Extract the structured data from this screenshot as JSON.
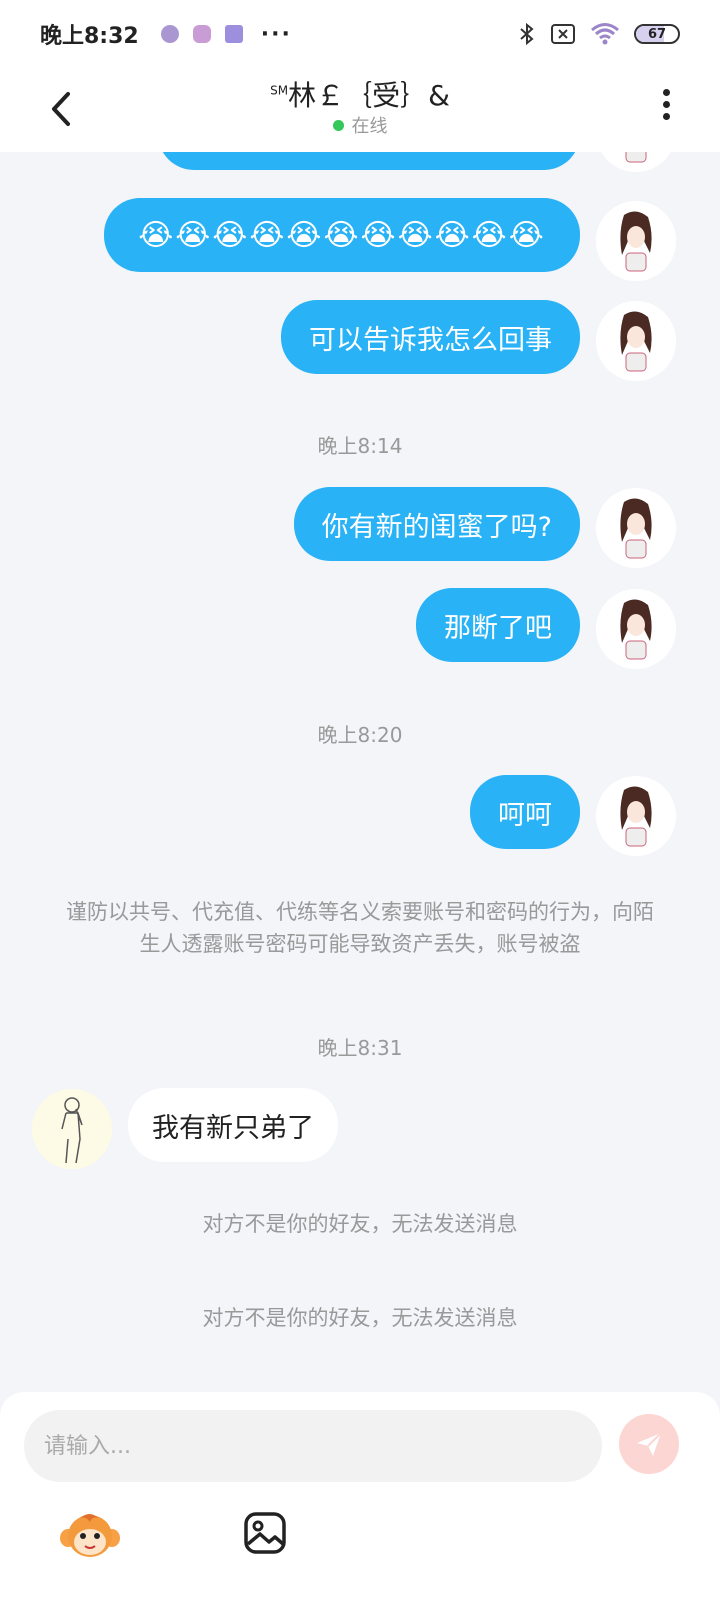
{
  "status_bar": {
    "time": "晚上8:32",
    "dots": "···",
    "battery": "67",
    "battery_level": 0.67
  },
  "header": {
    "title": "林￡｛受｝&",
    "title_superscript": "SM",
    "status": "在线"
  },
  "messages": [
    {
      "type": "out",
      "emoji": "😭😭😭😭😭😭😭😭😭😭😭"
    },
    {
      "type": "out",
      "text": "可以告诉我怎么回事"
    },
    {
      "type": "time",
      "text": "晚上8:14"
    },
    {
      "type": "out",
      "text": "你有新的闺蜜了吗?"
    },
    {
      "type": "out",
      "text": "那断了吧"
    },
    {
      "type": "time",
      "text": "晚上8:20"
    },
    {
      "type": "out",
      "text": "呵呵"
    },
    {
      "type": "notice",
      "text": "谨防以共号、代充值、代练等名义索要账号和密码的行为，向陌生人透露账号密码可能导致资产丢失，账号被盗"
    },
    {
      "type": "time",
      "text": "晚上8:31"
    },
    {
      "type": "in",
      "text": "我有新只弟了"
    },
    {
      "type": "notice",
      "text": "对方不是你的好友，无法发送消息"
    },
    {
      "type": "notice",
      "text": "对方不是你的好友，无法发送消息"
    }
  ],
  "input": {
    "placeholder": "请输入..."
  },
  "colors": {
    "bubble_out": "#29b2f6",
    "bubble_in": "#ffffff",
    "background": "#f3f5f8",
    "send_button": "#fbd6d3",
    "online": "#34c759"
  },
  "icons": {
    "back": "chevron-left-icon",
    "more": "more-vertical-icon",
    "send": "send-icon",
    "emoji_tool": "monkey-emoji-icon",
    "image_tool": "image-icon"
  }
}
